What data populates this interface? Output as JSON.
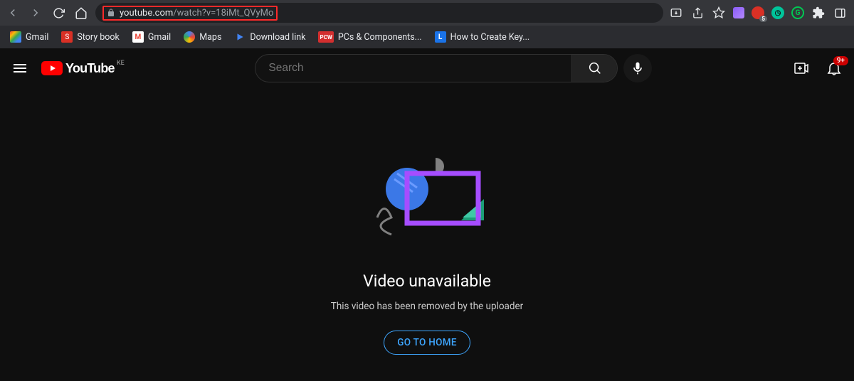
{
  "browser": {
    "url_host": "youtube.com",
    "url_path": "/watch?v=18iMt_QVyMo"
  },
  "bookmarks": [
    {
      "label": "Gmail"
    },
    {
      "label": "Story book"
    },
    {
      "label": "Gmail"
    },
    {
      "label": "Maps"
    },
    {
      "label": "Download link"
    },
    {
      "label": "PCs & Components..."
    },
    {
      "label": "How to Create Key..."
    }
  ],
  "youtube": {
    "logo_text": "YouTube",
    "region": "KE",
    "search_placeholder": "Search",
    "notification_badge": "9+"
  },
  "error": {
    "title": "Video unavailable",
    "subtitle": "This video has been removed by the uploader",
    "home_button": "GO TO HOME"
  }
}
